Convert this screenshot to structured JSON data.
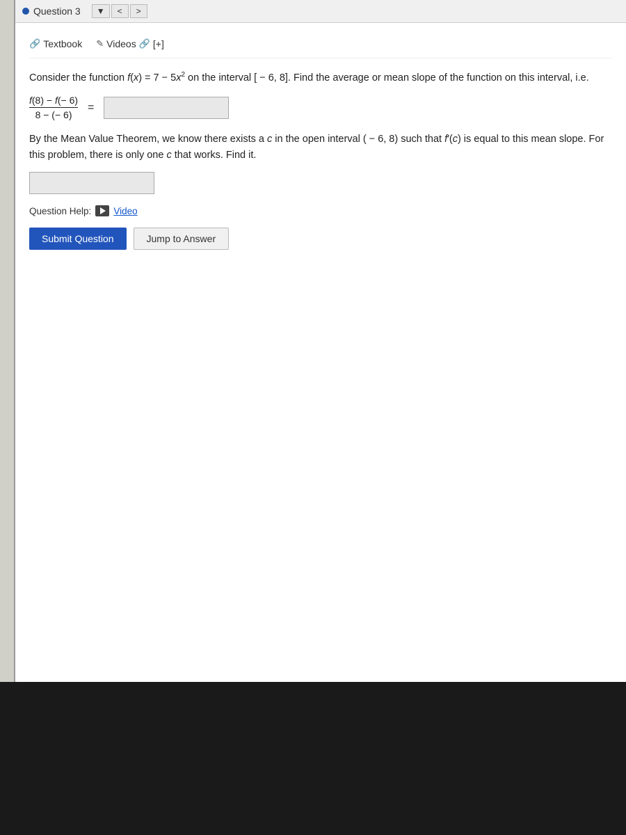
{
  "toolbar": {
    "question_label": "Question 3",
    "dropdown_arrow": "▼",
    "nav_back": "<",
    "nav_forward": ">"
  },
  "resources": {
    "textbook_label": "Textbook",
    "textbook_icon": "🔗",
    "videos_label": "Videos",
    "videos_icon": "✎",
    "plus_label": "[+]"
  },
  "problem": {
    "text1": "Consider the function f(x) = 7 − 5x² on the interval [ − 6, 8]. Find the average or mean slope of the",
    "text2": "function on this interval, i.e.",
    "fraction_num": "f(8) − f(−6)",
    "fraction_den": "8 − (−6)",
    "mvt_text1": "By the Mean Value Theorem, we know there exists a c in the open interval (−6, 8) such that f′(c) is equal",
    "mvt_text2": "to this mean slope. For this problem, there is only one c that works. Find it.",
    "question_help_label": "Question Help:",
    "video_label": "Video"
  },
  "buttons": {
    "submit": "Submit Question",
    "jump": "Jump to Answer"
  },
  "colors": {
    "dot": "#2255aa",
    "submit_bg": "#2255bb",
    "answer_bg": "#e8e8e8"
  }
}
